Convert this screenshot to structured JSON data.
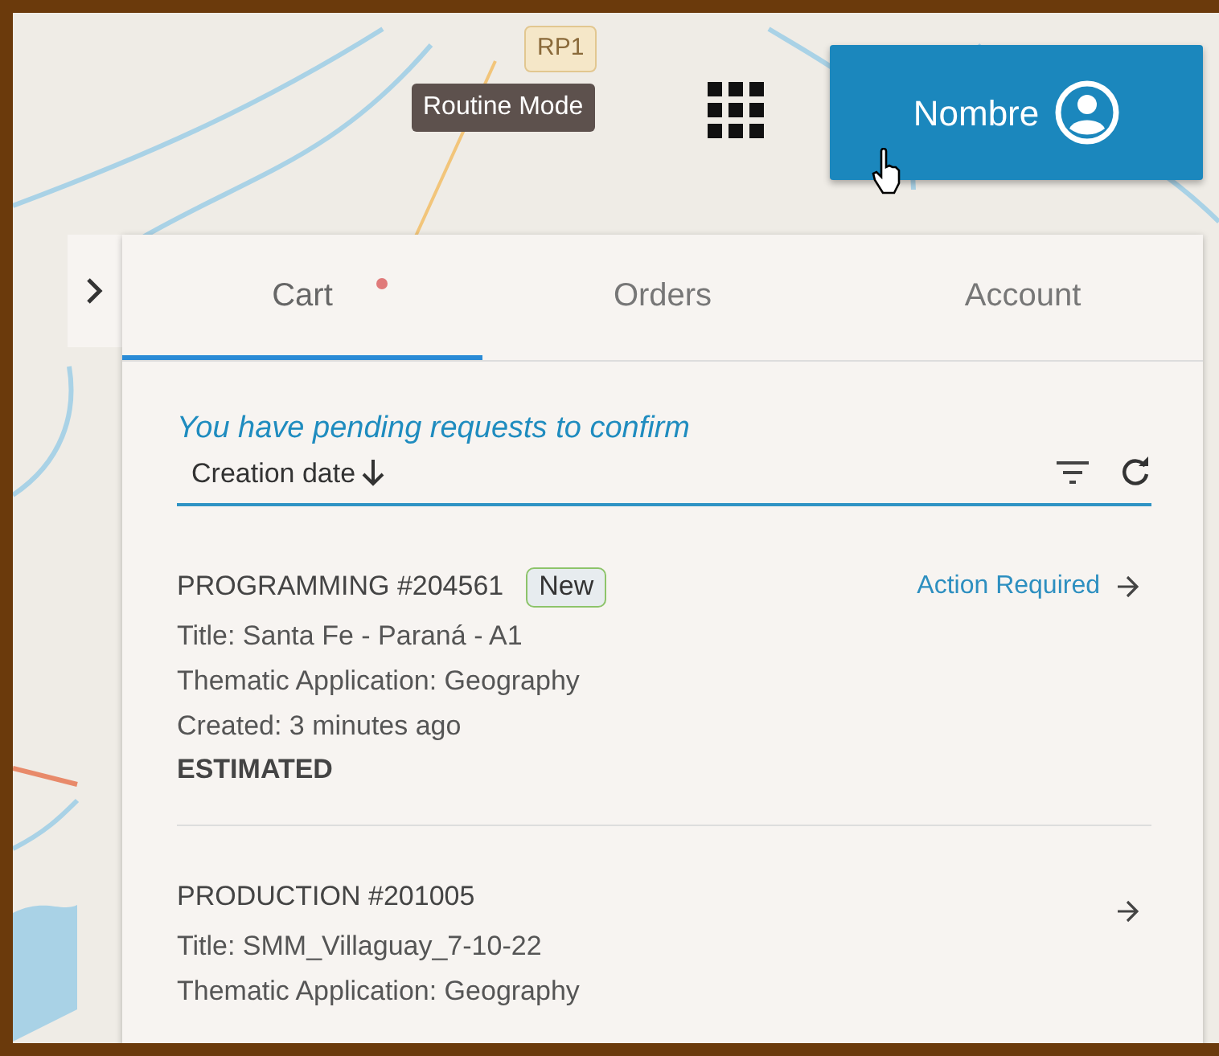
{
  "map": {
    "road_label": "RP1"
  },
  "mode_tooltip": "Routine Mode",
  "user_button": {
    "label": "Nombre"
  },
  "tabs": [
    {
      "label": "Cart",
      "selected": true,
      "notification": true
    },
    {
      "label": "Orders",
      "selected": false,
      "notification": false
    },
    {
      "label": "Account",
      "selected": false,
      "notification": false
    }
  ],
  "notice": "You have pending requests to confirm",
  "sort": {
    "label": "Creation date"
  },
  "orders": [
    {
      "heading": "PROGRAMMING #204561",
      "badge": "New",
      "status": "Action Required",
      "lines": [
        "Title: Santa Fe - Paraná - A1",
        "Thematic Application: Geography",
        "Created: 3 minutes ago"
      ],
      "state": "ESTIMATED"
    },
    {
      "heading": "PRODUCTION #201005",
      "lines": [
        "Title: SMM_Villaguay_7-10-22",
        "Thematic Application: Geography"
      ]
    }
  ]
}
